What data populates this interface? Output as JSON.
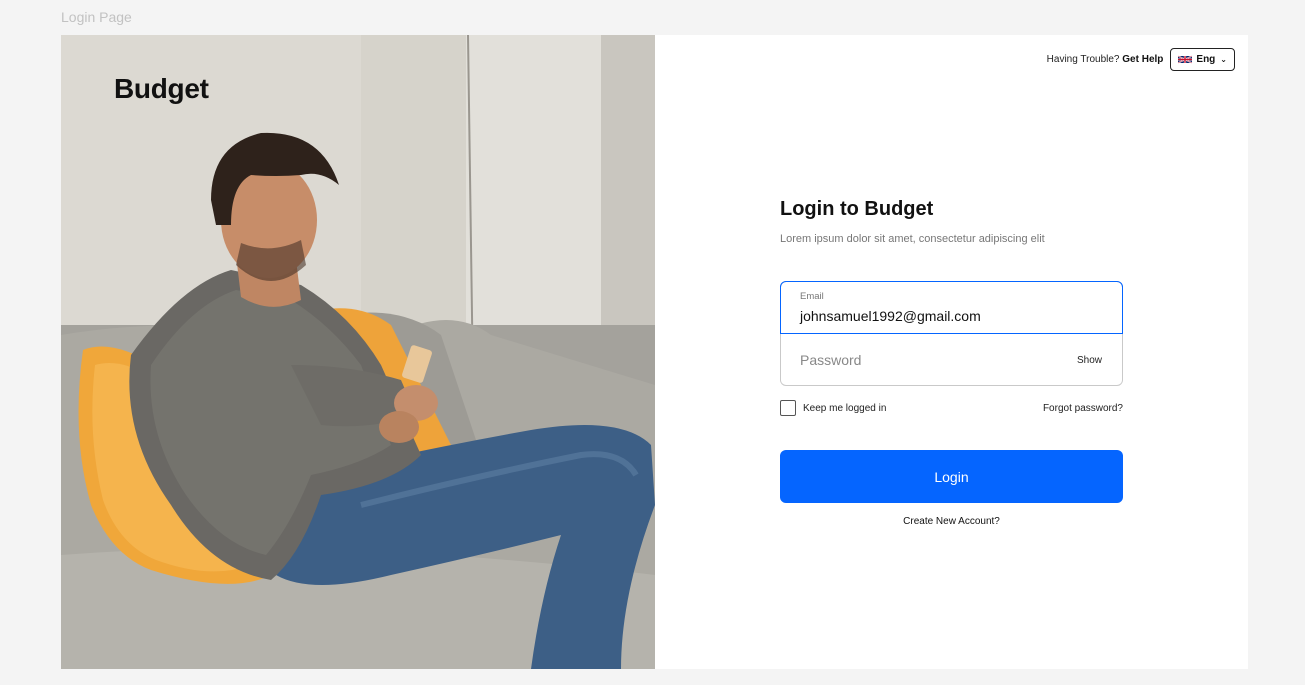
{
  "canvas": {
    "title": "Login Page"
  },
  "hero": {
    "brand": "Budget",
    "photo_subject": "man-on-couch-with-phone"
  },
  "header": {
    "trouble_text": "Having Trouble?",
    "help_link": "Get Help",
    "language": {
      "label": "Eng",
      "flag": "uk-flag-icon",
      "icon": "chevron-down-icon"
    }
  },
  "form": {
    "title": "Login to Budget",
    "subtitle": "Lorem ipsum dolor sit amet, consectetur adipiscing elit",
    "email": {
      "label": "Email",
      "value": "johnsamuel1992@gmail.com"
    },
    "password": {
      "placeholder": "Password",
      "toggle_label": "Show"
    },
    "remember_label": "Keep me logged in",
    "remember_checked": false,
    "forgot_label": "Forgot password?",
    "submit_label": "Login",
    "create_account_label": "Create New Account?"
  },
  "colors": {
    "accent": "#0565ff",
    "focus_border": "#0565ff",
    "background": "#f4f4f4"
  }
}
